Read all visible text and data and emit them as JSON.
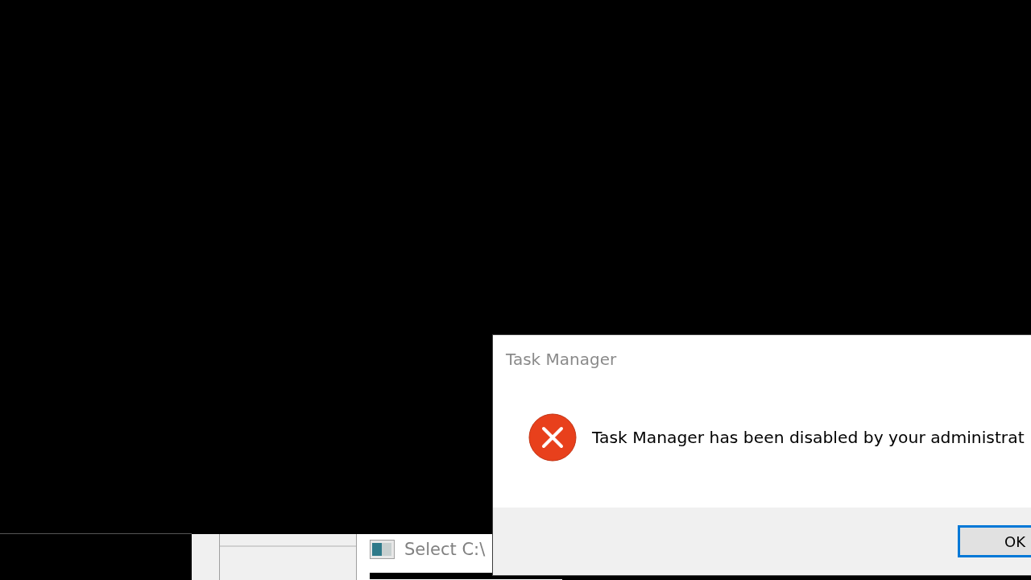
{
  "background_window": {
    "title": "Select C:\\"
  },
  "dialog": {
    "title": "Task Manager",
    "message": "Task Manager has been disabled by your administrat",
    "buttons": [
      {
        "label": "OK",
        "focused": true
      }
    ]
  }
}
